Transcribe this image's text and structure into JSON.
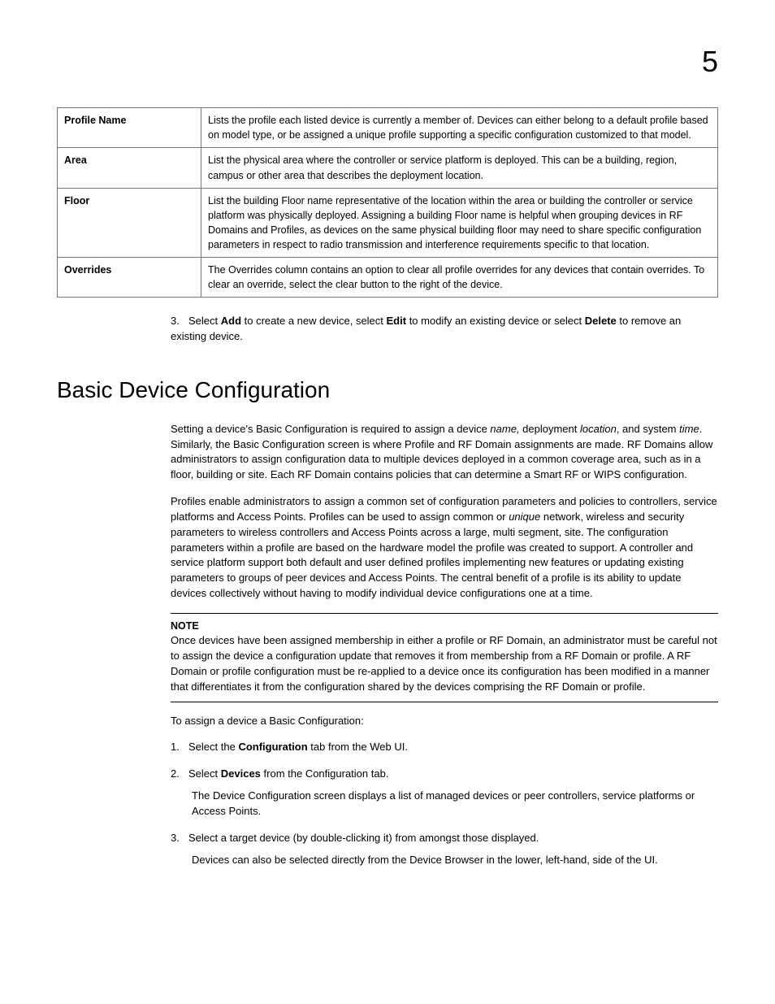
{
  "chapter_num": "5",
  "table": {
    "rows": [
      {
        "term": "Profile Name",
        "def": "Lists the profile each listed device is currently a member of. Devices can either belong to a default profile based on model type, or be assigned a unique profile supporting a specific configuration customized to that model."
      },
      {
        "term": "Area",
        "def": "List the physical area where the controller or service platform is deployed. This can be a building, region, campus or other area that describes the deployment location."
      },
      {
        "term": "Floor",
        "def": "List the building Floor name representative of the location within the area or building the controller or service platform was physically deployed. Assigning a building Floor name is helpful when grouping devices in RF Domains and Profiles, as devices on the same physical building floor may need to share specific configuration parameters in respect to radio transmission and interference requirements specific to that location."
      },
      {
        "term": "Overrides",
        "def": "The Overrides column contains an option to clear all profile overrides for any devices that contain overrides. To clear an override, select the clear button to the right of the device."
      }
    ]
  },
  "step3": {
    "num": "3.",
    "pre": "Select ",
    "b1": "Add",
    "mid1": " to create a new device, select ",
    "b2": "Edit",
    "mid2": " to modify an existing device or select ",
    "b3": "Delete",
    "post": " to remove an existing device."
  },
  "section_title": "Basic Device Configuration",
  "p1": {
    "t1": "Setting a device's Basic Configuration is required to assign a device ",
    "i1": "name,",
    "t2": " deployment ",
    "i2": "location",
    "t3": ", and system ",
    "i3": "time",
    "t4": ". Similarly, the Basic Configuration screen is where Profile and RF Domain assignments are made. RF Domains allow administrators to assign configuration data to multiple devices deployed in a common coverage area, such as in a floor, building or site. Each RF Domain contains policies that can determine a Smart RF or WIPS configuration."
  },
  "p2": {
    "t1": "Profiles enable administrators to assign a common set of configuration parameters and policies to controllers, service platforms and Access Points. Profiles can be used to assign common or ",
    "i1": "unique",
    "t2": " network, wireless and security parameters to wireless controllers and Access Points across a large, multi segment, site. The configuration parameters within a profile are based on the hardware model the profile was created to support. A controller and service platform support both default and user defined profiles implementing new features or updating existing parameters to groups of peer devices and Access Points. The central benefit of a profile is its ability to update devices collectively without having to modify individual device configurations one at a time."
  },
  "note": {
    "label": "NOTE",
    "body": "Once devices have been assigned membership in either a profile or RF Domain, an administrator must be careful not to assign the device a configuration update that removes it from membership from a RF Domain or profile. A RF Domain or profile configuration must be re-applied to a device once its configuration has been modified in a manner that differentiates it from the configuration shared by the devices comprising the RF Domain or profile."
  },
  "p3": "To assign a device a Basic Configuration:",
  "steps": {
    "s1": {
      "num": "1.",
      "t1": "Select the ",
      "b1": "Configuration",
      "t2": " tab from the Web UI."
    },
    "s2": {
      "num": "2.",
      "t1": "Select ",
      "b1": "Devices",
      "t2": " from the Configuration tab.",
      "sub": "The Device Configuration screen displays a list of managed devices or peer controllers, service platforms or Access Points."
    },
    "s3": {
      "num": "3.",
      "t1": "Select a target device (by double-clicking it) from amongst those displayed.",
      "sub": "Devices can also be selected directly from the Device Browser in the lower, left-hand, side of the UI."
    }
  }
}
